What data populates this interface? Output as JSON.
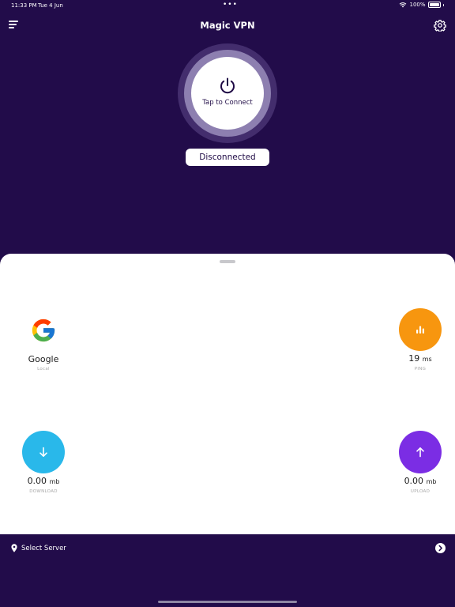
{
  "status_bar": {
    "time": "11:33 PM",
    "date": "Tue 4 Jun",
    "dots": "•••",
    "battery": "100%"
  },
  "header": {
    "title": "Magic VPN",
    "menu_icon": "menu-icon",
    "settings_icon": "gear-icon"
  },
  "connect": {
    "label": "Tap to Connect",
    "icon": "power-icon"
  },
  "status": {
    "label": "Disconnected"
  },
  "stats": {
    "server": {
      "name": "Google",
      "sub": "Local",
      "icon": "google-logo"
    },
    "ping": {
      "value": "19",
      "unit": "ms",
      "label": "PING",
      "color": "#f7960f",
      "icon": "bar-chart-icon"
    },
    "download": {
      "value": "0.00",
      "unit": "mb",
      "label": "DOWNLOAD",
      "color": "#29b8ea",
      "icon": "arrow-down-icon"
    },
    "upload": {
      "value": "0.00",
      "unit": "mb",
      "label": "UPLOAD",
      "color": "#7b2de4",
      "icon": "arrow-up-icon"
    }
  },
  "footer": {
    "select_label": "Select Server",
    "pin_icon": "location-pin-icon",
    "arrow_icon": "chevron-right-icon"
  },
  "colors": {
    "background": "#220c4a",
    "sheet": "#ffffff"
  }
}
